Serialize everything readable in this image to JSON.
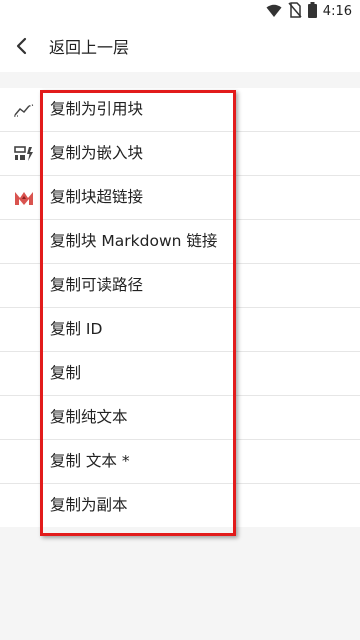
{
  "status_bar": {
    "time": "4:16",
    "icons": [
      "wifi-icon",
      "sim-no-signal-icon",
      "battery-icon"
    ]
  },
  "header": {
    "back_icon": "chevron-left-icon",
    "title": "返回上一层"
  },
  "menu": {
    "items": [
      {
        "label": "复制为引用块",
        "icon": "sparkline-icon"
      },
      {
        "label": "复制为嵌入块",
        "icon": "embed-block-icon"
      },
      {
        "label": "复制块超链接",
        "icon": "markdown-logo-icon"
      },
      {
        "label": "复制块 Markdown 链接",
        "icon": ""
      },
      {
        "label": "复制可读路径",
        "icon": ""
      },
      {
        "label": "复制 ID",
        "icon": ""
      },
      {
        "label": "复制",
        "icon": ""
      },
      {
        "label": "复制纯文本",
        "icon": ""
      },
      {
        "label": "复制 文本 *",
        "icon": ""
      },
      {
        "label": "复制为副本",
        "icon": ""
      }
    ]
  },
  "colors": {
    "highlight_border": "#e21b1b",
    "markdown_icon_red": "#d9534f"
  }
}
